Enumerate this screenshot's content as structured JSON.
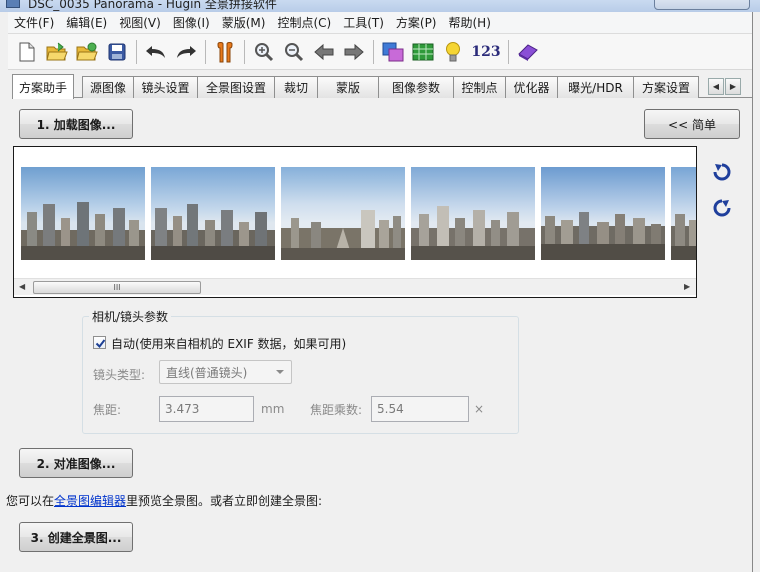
{
  "window": {
    "title": "DSC_0035 Panorama - Hugin 全景拼接软件"
  },
  "menu": [
    {
      "label": "文件(F)"
    },
    {
      "label": "编辑(E)"
    },
    {
      "label": "视图(V)"
    },
    {
      "label": "图像(I)"
    },
    {
      "label": "蒙版(M)"
    },
    {
      "label": "控制点(C)"
    },
    {
      "label": "工具(T)"
    },
    {
      "label": "方案(P)"
    },
    {
      "label": "帮助(H)"
    }
  ],
  "toolbar": {
    "icons": [
      "new-document-icon",
      "open-folder-icon",
      "open-folder-add-icon",
      "save-icon",
      "undo-icon",
      "redo-icon",
      "assistant-tools-icon",
      "zoom-in-icon",
      "zoom-out-icon",
      "back-arrow-icon",
      "forward-arrow-icon",
      "preview-icon",
      "table-icon",
      "lightbulb-icon",
      "control-points-icon",
      "eraser-icon"
    ],
    "number_label": "123"
  },
  "tabs": [
    {
      "label": "方案助手",
      "active": true
    },
    {
      "label": "源图像"
    },
    {
      "label": "镜头设置"
    },
    {
      "label": "全景图设置"
    },
    {
      "label": "裁切"
    },
    {
      "label": "蒙版"
    },
    {
      "label": "图像参数"
    },
    {
      "label": "控制点"
    },
    {
      "label": "优化器"
    },
    {
      "label": "曝光/HDR"
    },
    {
      "label": "方案设置"
    }
  ],
  "assistant": {
    "load_button": "1. 加载图像...",
    "simple_button": "<< 简单",
    "scrollbar_grip": "III",
    "lens_group": {
      "title": "相机/镜头参数",
      "auto_checked": true,
      "auto_label": "自动(使用来自相机的 EXIF 数据，如果可用)",
      "lens_type_label": "镜头类型:",
      "lens_type_value": "直线(普通镜头)",
      "focal_label": "焦距:",
      "focal_value": "3.473",
      "focal_unit": "mm",
      "crop_label": "焦距乘数:",
      "crop_value": "5.54",
      "crop_unit": "×"
    },
    "align_button": "2. 对准图像...",
    "hint_prefix": "您可以在",
    "hint_link": "全景图编辑器",
    "hint_suffix": "里预览全景图。或者立即创建全景图:",
    "create_button": "3. 创建全景图..."
  },
  "colors": {
    "accent_blue": "#0033cc",
    "tab_border": "#8e8f8f"
  }
}
